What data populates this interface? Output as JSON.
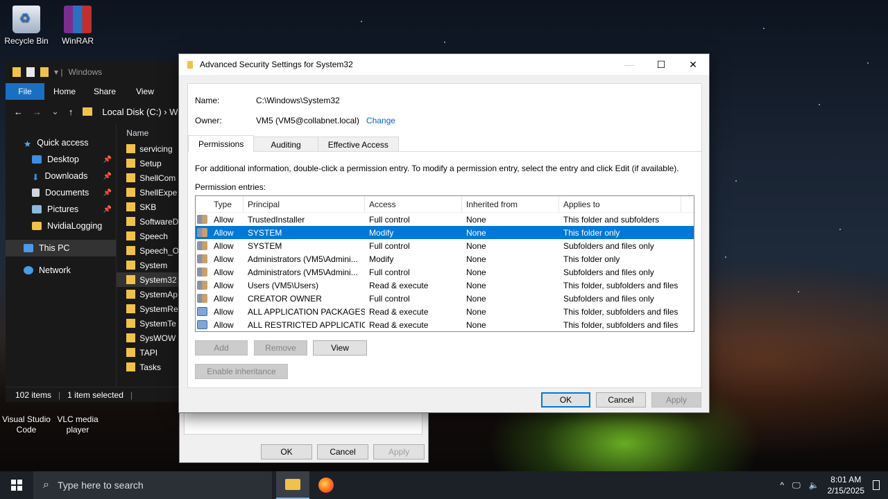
{
  "desktop": {
    "icons": [
      {
        "label": "Recycle Bin",
        "icon": "recycle-bin-icon"
      },
      {
        "label": "WinRAR",
        "icon": "winrar-icon"
      },
      {
        "label": "Visual Studio Code",
        "icon": "vscode-icon"
      },
      {
        "label": "VLC media player",
        "icon": "vlc-icon"
      }
    ]
  },
  "explorer": {
    "title": "Windows",
    "ribbon": {
      "file": "File",
      "home": "Home",
      "share": "Share",
      "view": "View"
    },
    "address": "Local Disk (C:)",
    "address_tail": "W",
    "nav": [
      {
        "label": "Quick access",
        "pinned": false
      },
      {
        "label": "Desktop",
        "pinned": true
      },
      {
        "label": "Downloads",
        "pinned": true
      },
      {
        "label": "Documents",
        "pinned": true
      },
      {
        "label": "Pictures",
        "pinned": true
      },
      {
        "label": "NvidiaLogging",
        "pinned": false
      },
      {
        "label": "This PC",
        "pinned": false
      },
      {
        "label": "Network",
        "pinned": false
      }
    ],
    "column_name": "Name",
    "files": [
      "servicing",
      "Setup",
      "ShellCom",
      "ShellExpe",
      "SKB",
      "SoftwareD",
      "Speech",
      "Speech_O",
      "System",
      "System32",
      "SystemAp",
      "SystemRe",
      "SystemTe",
      "SysWOW",
      "TAPI",
      "Tasks"
    ],
    "status_items": "102 items",
    "status_selected": "1 item selected"
  },
  "props_dialog": {
    "ok": "OK",
    "cancel": "Cancel",
    "apply": "Apply"
  },
  "dialog": {
    "title": "Advanced Security Settings for System32",
    "name_label": "Name:",
    "name_value": "C:\\Windows\\System32",
    "owner_label": "Owner:",
    "owner_value": "VM5 (VM5@collabnet.local)",
    "change_link": "Change",
    "tabs": [
      "Permissions",
      "Auditing",
      "Effective Access"
    ],
    "info_text": "For additional information, double-click a permission entry. To modify a permission entry, select the entry and click Edit (if available).",
    "entries_label": "Permission entries:",
    "columns": [
      "Type",
      "Principal",
      "Access",
      "Inherited from",
      "Applies to"
    ],
    "entries": [
      {
        "type": "Allow",
        "principal": "TrustedInstaller",
        "access": "Full control",
        "inherited": "None",
        "applies": "This folder and subfolders",
        "icon": "user-group-icon"
      },
      {
        "type": "Allow",
        "principal": "SYSTEM",
        "access": "Modify",
        "inherited": "None",
        "applies": "This folder only",
        "icon": "user-group-icon"
      },
      {
        "type": "Allow",
        "principal": "SYSTEM",
        "access": "Full control",
        "inherited": "None",
        "applies": "Subfolders and files only",
        "icon": "user-group-icon"
      },
      {
        "type": "Allow",
        "principal": "Administrators (VM5\\Admini...",
        "access": "Modify",
        "inherited": "None",
        "applies": "This folder only",
        "icon": "user-group-icon"
      },
      {
        "type": "Allow",
        "principal": "Administrators (VM5\\Admini...",
        "access": "Full control",
        "inherited": "None",
        "applies": "Subfolders and files only",
        "icon": "user-group-icon"
      },
      {
        "type": "Allow",
        "principal": "Users (VM5\\Users)",
        "access": "Read & execute",
        "inherited": "None",
        "applies": "This folder, subfolders and files",
        "icon": "user-group-icon"
      },
      {
        "type": "Allow",
        "principal": "CREATOR OWNER",
        "access": "Full control",
        "inherited": "None",
        "applies": "Subfolders and files only",
        "icon": "user-group-icon"
      },
      {
        "type": "Allow",
        "principal": "ALL APPLICATION PACKAGES",
        "access": "Read & execute",
        "inherited": "None",
        "applies": "This folder, subfolders and files",
        "icon": "package-icon"
      },
      {
        "type": "Allow",
        "principal": "ALL RESTRICTED APPLICATIO...",
        "access": "Read & execute",
        "inherited": "None",
        "applies": "This folder, subfolders and files",
        "icon": "package-icon"
      }
    ],
    "selected_row": 1,
    "buttons": {
      "add": "Add",
      "remove": "Remove",
      "view": "View",
      "enable_inheritance": "Enable inheritance"
    },
    "footer": {
      "ok": "OK",
      "cancel": "Cancel",
      "apply": "Apply"
    }
  },
  "taskbar": {
    "search_placeholder": "Type here to search",
    "time": "8:01 AM",
    "date": "2/15/2025"
  },
  "colors": {
    "accent": "#0078d7",
    "link": "#0066cc",
    "folder": "#f1c24a",
    "taskbar": "#1c2027"
  }
}
